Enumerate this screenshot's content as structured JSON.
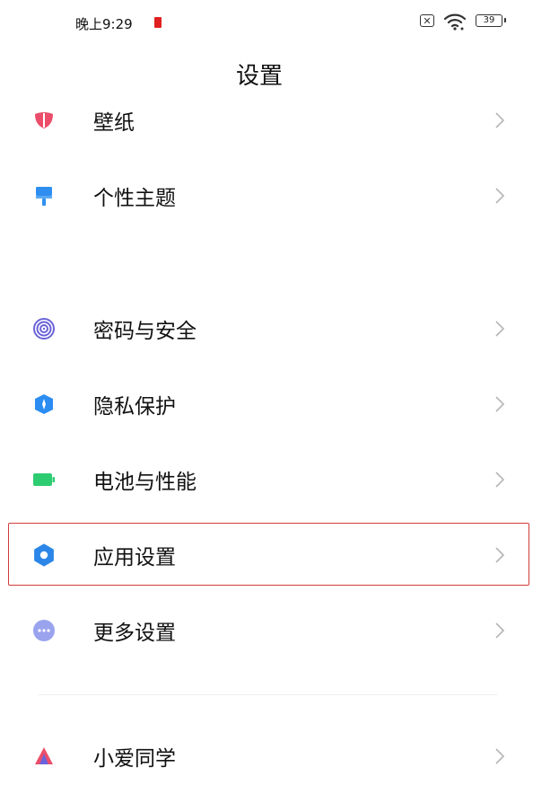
{
  "status_bar": {
    "time": "晚上9:29",
    "battery": "39"
  },
  "header": {
    "title": "设置"
  },
  "items": [
    {
      "label": "壁纸",
      "icon": "wallpaper-icon"
    },
    {
      "label": "个性主题",
      "icon": "theme-brush-icon"
    },
    {
      "label": "密码与安全",
      "icon": "fingerprint-icon"
    },
    {
      "label": "隐私保护",
      "icon": "privacy-shield-icon"
    },
    {
      "label": "电池与性能",
      "icon": "battery-icon"
    },
    {
      "label": "应用设置",
      "icon": "gear-icon",
      "highlighted": true
    },
    {
      "label": "更多设置",
      "icon": "more-dots-icon"
    },
    {
      "label": "小爱同学",
      "icon": "xiaoai-icon"
    }
  ],
  "colors": {
    "highlight_border": "#d23b3b",
    "wallpaper": "#ec4d6a",
    "theme": "#2f8ff0",
    "fingerprint": "#6b63d8",
    "privacy": "#2b8df2",
    "battery": "#2ecc71",
    "gear": "#2b86e8",
    "more": "#9aa3ee"
  }
}
